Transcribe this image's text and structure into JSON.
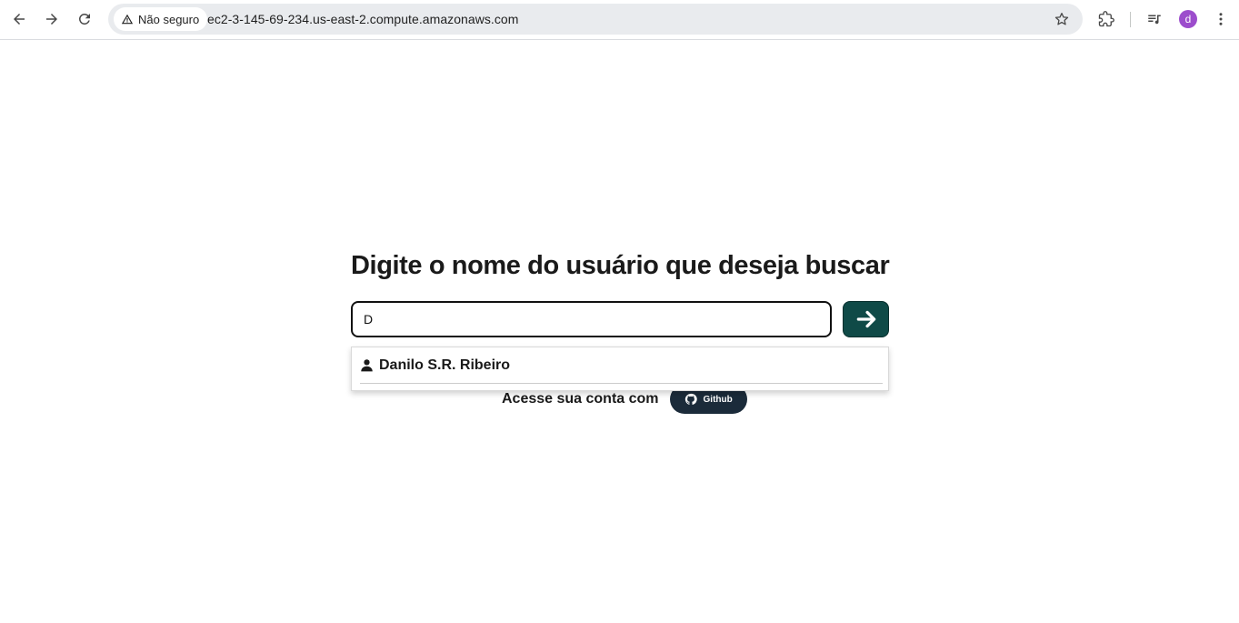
{
  "browser": {
    "security_label": "Não seguro",
    "url": "ec2-3-145-69-234.us-east-2.compute.amazonaws.com",
    "profile_initial": "d",
    "profile_color": "#9c4dcc"
  },
  "page": {
    "heading": "Digite o nome do usuário que deseja buscar",
    "search": {
      "value": "D",
      "placeholder": ""
    },
    "suggestions": [
      {
        "label": "Danilo S.R. Ribeiro",
        "icon": "user-icon"
      }
    ],
    "login": {
      "label": "Acesse sua conta com",
      "github_label": "Github"
    },
    "colors": {
      "search_button": "#0f4a47",
      "github_button": "#1b2b3a"
    }
  }
}
